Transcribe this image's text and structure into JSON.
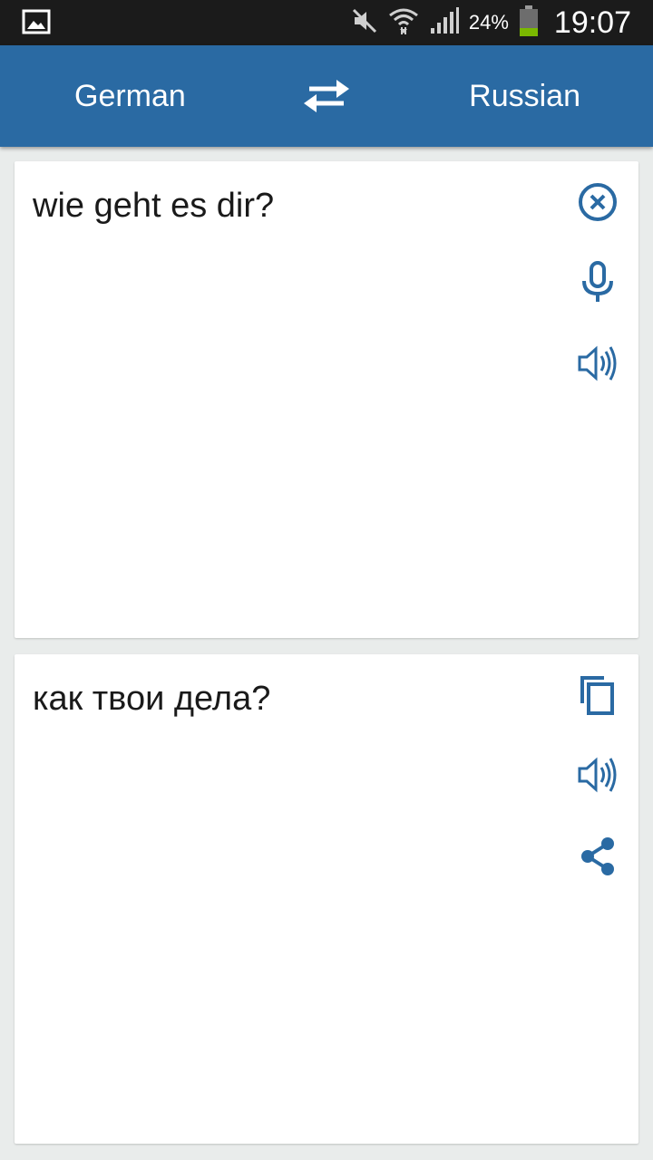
{
  "status_bar": {
    "battery_percent": "24%",
    "time": "19:07",
    "icons": [
      "gallery-icon",
      "mute-icon",
      "wifi-icon",
      "signal-icon",
      "battery-icon"
    ]
  },
  "header": {
    "source_language": "German",
    "target_language": "Russian",
    "swap_icon": "swap-arrows-icon"
  },
  "input_card": {
    "text": "wie geht es dir?",
    "icons": [
      "clear-icon",
      "microphone-icon",
      "speaker-icon"
    ]
  },
  "output_card": {
    "text": "как твои дела?",
    "icons": [
      "copy-icon",
      "speaker-icon",
      "share-icon"
    ]
  },
  "colors": {
    "primary": "#2a6aa3",
    "status_bar": "#1b1b1b",
    "background": "#e9eceb",
    "icon": "#2a6aa3",
    "battery_level": "#7ab800"
  }
}
